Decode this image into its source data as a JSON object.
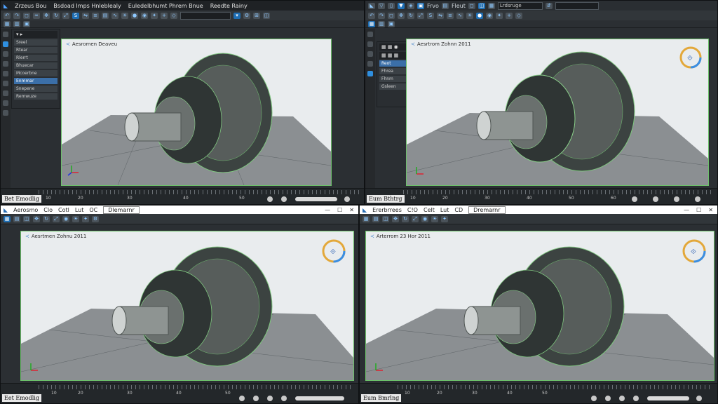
{
  "panes": {
    "top_left": {
      "menu": [
        "Zrzeus Bou",
        "Bsdoad Imps Hnleblealy",
        "Euledelbhumt Phrem Bnue",
        "Reedte Rainy"
      ],
      "viewport_label": "Aesromen Deaveu",
      "status_title": "Bet Emodlig",
      "timeline_ticks": [
        "10",
        "20",
        "30",
        "40",
        "50"
      ],
      "panel_items": [
        "Sreel",
        "Rtear",
        "Rlerrt",
        "Bhuecar",
        "Mcoerbne",
        "Enmmar",
        "Snepene",
        "Remwuze"
      ]
    },
    "top_right": {
      "toolbar_labels": [
        "Frvo",
        "Fleut"
      ],
      "field_value": "Lrdsruge",
      "viewport_label": "Aesrtrom Zohnn 2011",
      "status_title": "Eum Bthtrg",
      "timeline_ticks": [
        "10",
        "20",
        "30",
        "40",
        "50",
        "60"
      ],
      "panel_items": [
        "Reot",
        "Fhrea",
        "Fhnm",
        "Gsleen"
      ]
    },
    "bottom_left": {
      "title": [
        "Aerosmo",
        "Clo",
        "Cotl",
        "Lut",
        "OC"
      ],
      "dropdown": "Dlemarnr",
      "viewport_label": "Aesrtmen Zohnu 2011",
      "status_title": "Eet Emodlig",
      "timeline_ticks": [
        "10",
        "20",
        "30",
        "40",
        "50"
      ]
    },
    "bottom_right": {
      "title": [
        "Ererbrrees",
        "C!O",
        "Celt",
        "Lut",
        "CD"
      ],
      "dropdown": "Dremarnr",
      "viewport_label": "Arterrom 23 Hor 2011",
      "status_title": "Eum Bmrlng",
      "timeline_ticks": [
        "10",
        "20",
        "30",
        "40",
        "50"
      ]
    }
  },
  "colors": {
    "accent": "#2f8fe0",
    "selection": "#6cc06a",
    "model": "#4b5350"
  },
  "icons": [
    "max-logo-icon",
    "axis-gizmo-icon",
    "view-cube-icon",
    "play-icon",
    "close-icon",
    "maximize-icon"
  ]
}
